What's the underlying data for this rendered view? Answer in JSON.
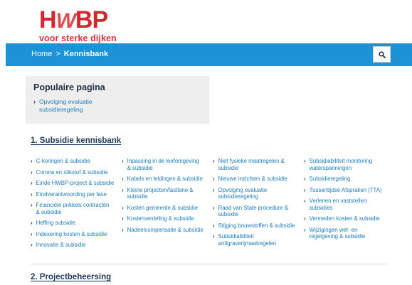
{
  "logo": {
    "brand_h": "H",
    "brand_w": "W",
    "brand_bp": "BP",
    "tagline": "voor sterke dijken"
  },
  "nav": {
    "home": "Home",
    "separator": ">",
    "current": "Kennisbank",
    "search_icon": "search-icon"
  },
  "popular": {
    "title": "Populaire pagina",
    "items": [
      "Opvolging evaluatie subsidieregeling"
    ]
  },
  "sections": [
    {
      "title": "1. Subsidie kennisbank",
      "columns": [
        [
          "C-koringen & subsidie",
          "Corona en stikstof & subsidie",
          "Einde HWBP-project & subsidie",
          "Eindverantwoording per fase",
          "Financiële prikkels contracten & subsidie",
          "Heffing subsidie",
          "Indexering kosten & subsidie",
          "Innovatie & subsidie"
        ],
        [
          "Inpassing in de leefomgeving & subsidie",
          "Kabels en leidingen & subsidie",
          "Kleine projecten/fastlane & subsidie",
          "Kosten gemeente & subsidie",
          "Kostenverdeling & subsidie",
          "Nadeelcompensatie & subsidie"
        ],
        [
          "Niet fysieke maatregelen & subsidie",
          "Nieuwe inzichten & subsidie",
          "Opvolging evaluatie subsidieregeling",
          "Raad van State procedure & subsidie",
          "Stijging bouwstoffen & subsidie",
          "Subsidiabiliteit antigraverijmaatregelen"
        ],
        [
          "Subsidiabiliteit monitoring waterspanningen",
          "Subsidieregeling",
          "Tussentijdse Afspraken (TTA)",
          "Verlenen en vaststellen subsidies",
          "Vermeden kosten & subsidie",
          "Wijzigingen wet- en regelgeving & subsidie"
        ]
      ]
    },
    {
      "title": "2. Projectbeheersing"
    }
  ],
  "colors": {
    "nav_bg": "#1b93d6",
    "link": "#1b7ec2",
    "brand_red": "#d8242c",
    "heading": "#1f3a5a"
  }
}
